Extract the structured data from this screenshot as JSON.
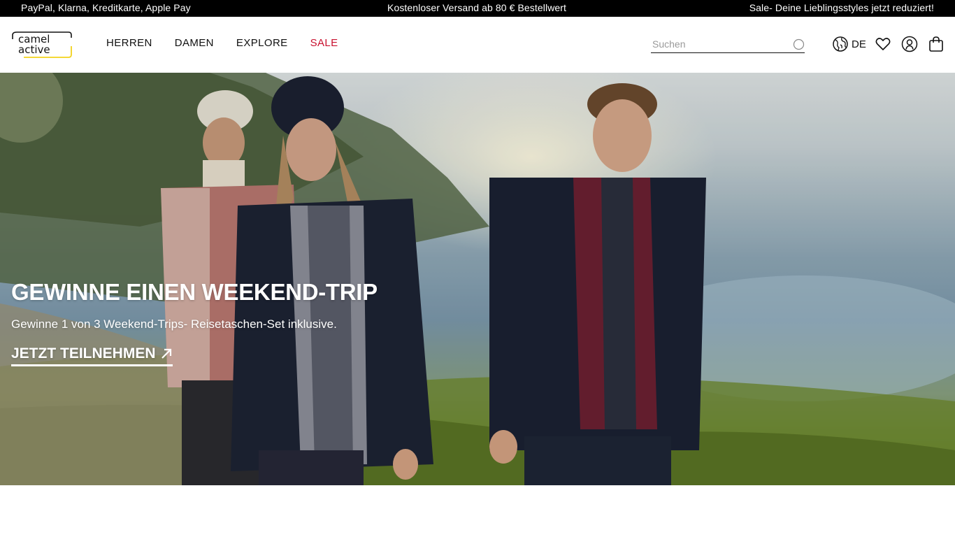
{
  "promo": {
    "left": "PayPal, Klarna, Kreditkarte, Apple Pay",
    "center": "Kostenloser Versand ab 80 € Bestellwert",
    "right": "Sale- Deine Lieblingsstyles jetzt reduziert!"
  },
  "header": {
    "logo_line1": "camel",
    "logo_line2": "active",
    "nav": [
      "HERREN",
      "DAMEN",
      "EXPLORE",
      "SALE"
    ],
    "search_placeholder": "Suchen",
    "language": "DE",
    "icons": [
      "globe-icon",
      "heart-icon",
      "user-icon",
      "shopping-bag-icon"
    ]
  },
  "hero": {
    "title": "GEWINNE EINEN WEEKEND-TRIP",
    "subtitle": "Gewinne 1 von 3 Weekend-Trips- Reisetaschen-Set inklusive.",
    "cta": "JETZT TEILNEHMEN"
  },
  "colors": {
    "promo_bg": "#000000",
    "sale": "#c8102e",
    "logo_accent": "#f2d21b"
  }
}
